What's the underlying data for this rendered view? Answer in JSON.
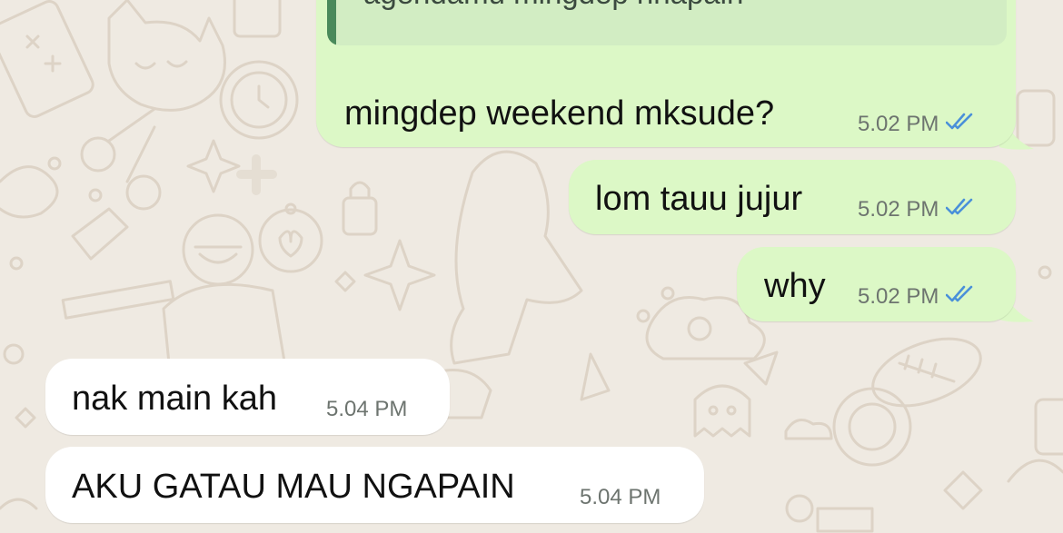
{
  "chat": {
    "theme": {
      "wallpaper": "#efeae2",
      "doodle": "#ddd3c6",
      "outgoing_bubble": "#dcf8c6",
      "incoming_bubble": "#ffffff",
      "quote_background": "#d2edc3",
      "quote_bar": "#4a8a5b",
      "read_tick": "#4a90d9"
    },
    "messages": [
      {
        "direction": "outgoing",
        "quoted_text": "agendamu mingdep nhapain",
        "text": "mingdep weekend mksude?",
        "time": "5.02 PM",
        "status_icon": "double-check-read-icon"
      },
      {
        "direction": "outgoing",
        "text": "lom tauu jujur",
        "time": "5.02 PM",
        "status_icon": "double-check-read-icon"
      },
      {
        "direction": "outgoing",
        "text": "why",
        "time": "5.02 PM",
        "status_icon": "double-check-read-icon"
      },
      {
        "direction": "incoming",
        "text": "nak main kah",
        "time": "5.04 PM"
      },
      {
        "direction": "incoming",
        "text": "AKU GATAU MAU NGAPAIN",
        "time": "5.04 PM"
      }
    ]
  }
}
